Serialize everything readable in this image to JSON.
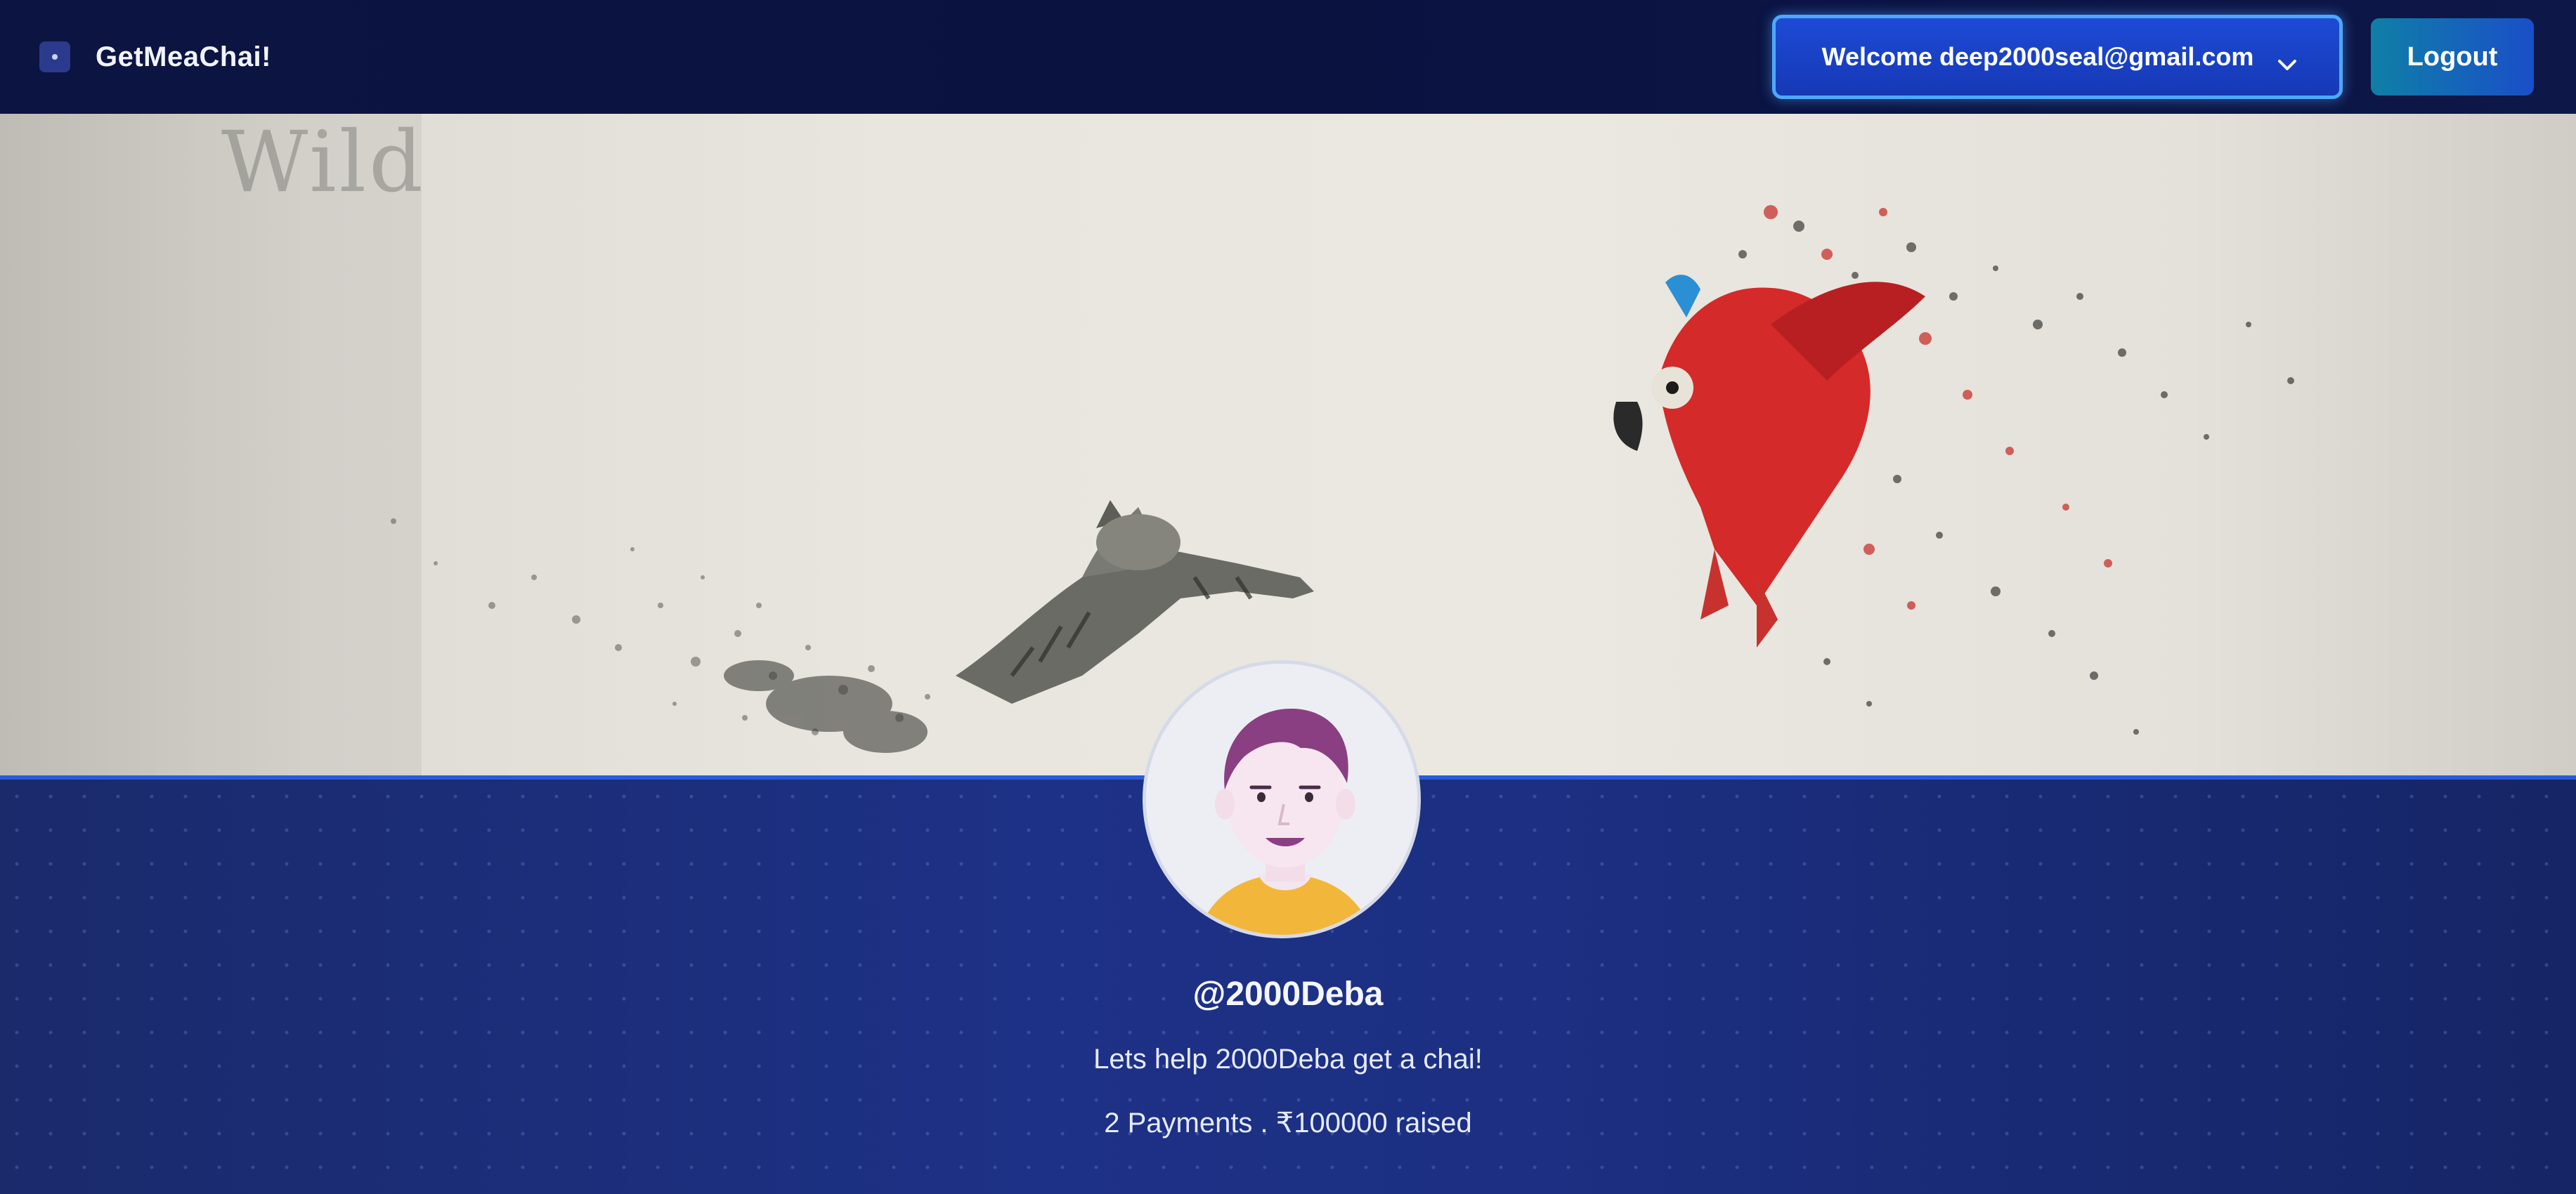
{
  "navbar": {
    "brand_name": "GetMeaChai!",
    "welcome_label": "Welcome deep2000seal@gmail.com",
    "logout_label": "Logout"
  },
  "cover": {
    "watermark_text": "Wild",
    "colors": {
      "parrot_red": "#d42a2a",
      "parrot_blue": "#2a8fd4",
      "cat_gray": "#6b6b66"
    }
  },
  "profile": {
    "username": "@2000Deba",
    "tagline": "Lets help 2000Deba get a chai!",
    "stats": "2 Payments . ₹100000 raised"
  },
  "colors": {
    "navbar_bg": "#0c1442",
    "welcome_btn_bg": "#1d4ad6",
    "welcome_btn_border": "#4ea8ff",
    "logout_btn_bg": "#1a4fc8",
    "profile_bg": "#1d3186"
  }
}
